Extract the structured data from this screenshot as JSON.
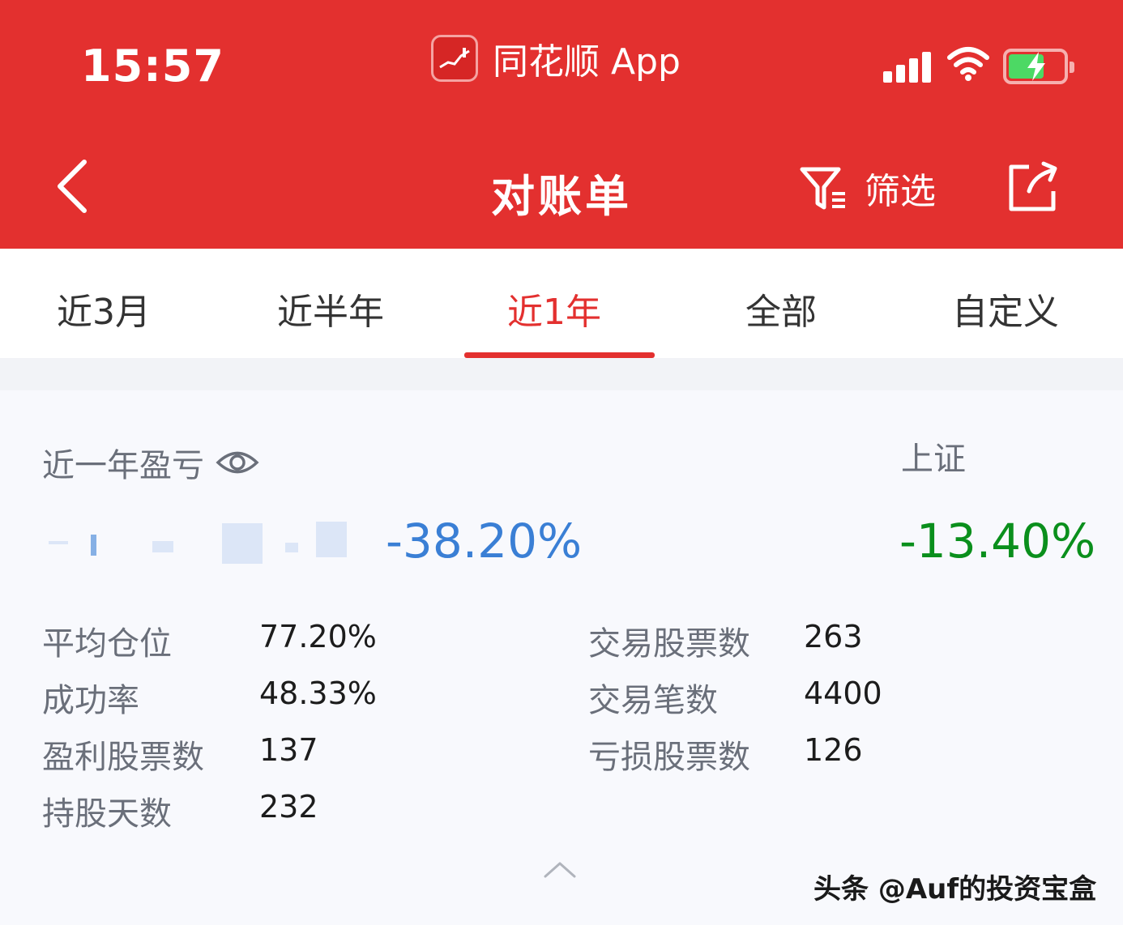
{
  "status_bar": {
    "time": "15:57",
    "app_name": "同花顺 App",
    "icons": [
      "app-logo-icon",
      "signal-icon",
      "wifi-icon",
      "battery-icon"
    ]
  },
  "nav": {
    "title": "对账单",
    "filter_label": "筛选",
    "icons": [
      "back-chevron-icon",
      "filter-icon",
      "share-icon"
    ]
  },
  "tabs": [
    {
      "label": "近3月",
      "active": false
    },
    {
      "label": "近半年",
      "active": false
    },
    {
      "label": "近1年",
      "active": true
    },
    {
      "label": "全部",
      "active": false
    },
    {
      "label": "自定义",
      "active": false
    }
  ],
  "summary": {
    "pl_label": "近一年盈亏",
    "pl_percent": "-38.20%",
    "benchmark_label": "上证",
    "benchmark_percent": "-13.40%",
    "colors": {
      "accent": "#e3302f",
      "loss_blue": "#3a7fd5",
      "benchmark_green": "#0a8f1c"
    }
  },
  "stats": {
    "left": [
      {
        "label": "平均仓位",
        "value": "77.20%"
      },
      {
        "label": "成功率",
        "value": "48.33%"
      },
      {
        "label": "盈利股票数",
        "value": "137"
      },
      {
        "label": "持股天数",
        "value": "232"
      }
    ],
    "right": [
      {
        "label": "交易股票数",
        "value": "263"
      },
      {
        "label": "交易笔数",
        "value": "4400"
      },
      {
        "label": "亏损股票数",
        "value": "126"
      }
    ]
  },
  "watermark": "头条 @Auf的投资宝盒"
}
